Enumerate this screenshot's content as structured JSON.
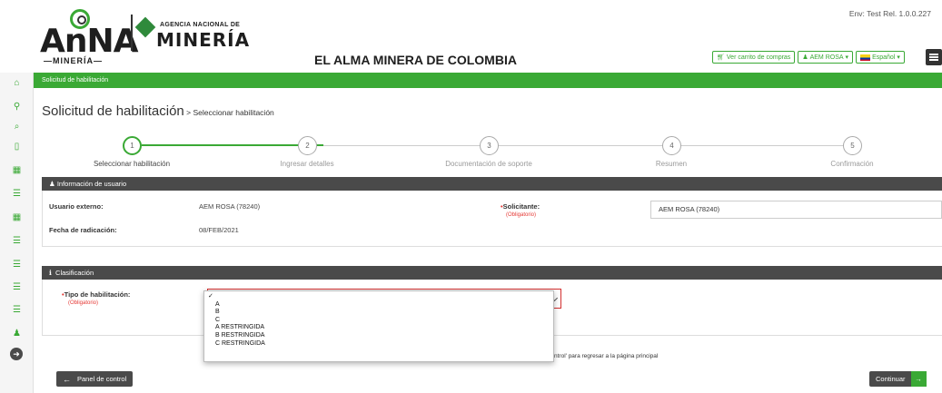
{
  "header": {
    "brand_anna": "AnNA",
    "brand_anna_sub": "—MINERÍA—",
    "agency_top": "AGENCIA NACIONAL DE",
    "agency_name": "MINERÍA",
    "site_title": "EL ALMA MINERA DE COLOMBIA",
    "env": "Env: Test Rel. 1.0.0.227",
    "cart_label": "Ver carrito de compras",
    "user_label": "AEM ROSA",
    "lang_label": "Español"
  },
  "sidebar": {
    "icons": [
      "home-icon",
      "map-marker-icon",
      "search-icon",
      "mobile-icon",
      "grid-icon",
      "list-icon",
      "grid-icon",
      "list-icon",
      "list-icon",
      "list-icon",
      "list-icon",
      "user-icon",
      "arrow-circle-icon"
    ]
  },
  "breadcrumb_bar": "Solicitud de habilitación",
  "page": {
    "title": "Solicitud de habilitación",
    "crumb": " > Seleccionar habilitación"
  },
  "stepper": [
    {
      "number": "1",
      "label": "Seleccionar habilitación",
      "active": true
    },
    {
      "number": "2",
      "label": "Ingresar detalles",
      "active": false
    },
    {
      "number": "3",
      "label": "Documentación de soporte",
      "active": false
    },
    {
      "number": "4",
      "label": "Resumen",
      "active": false
    },
    {
      "number": "5",
      "label": "Confirmación",
      "active": false
    }
  ],
  "user_info": {
    "heading": "Información de usuario",
    "external_user_label": "Usuario externo:",
    "external_user_value": "AEM ROSA (78240)",
    "date_label": "Fecha de radicación:",
    "date_value": "08/FEB/2021",
    "applicant_label": "Solicitante:",
    "applicant_required": "(Obligatorio)",
    "applicant_value": "AEM ROSA (78240)"
  },
  "classification": {
    "heading": "Clasificación",
    "type_label": "Tipo de habilitación:",
    "type_required": "(Obligatorio)",
    "options": [
      "",
      "A",
      "B",
      "C",
      "A RESTRINGIDA",
      "B RESTRINGIDA",
      "C RESTRINGIDA"
    ],
    "checkmark": "✓"
  },
  "hint": "ntrol' para regresar a la página principal",
  "footer": {
    "back_label": "Panel de control",
    "continue_label": "Continuar"
  },
  "colors": {
    "accent": "#3aa935",
    "dark_panel": "#4a4a4a",
    "required": "#e53935"
  }
}
